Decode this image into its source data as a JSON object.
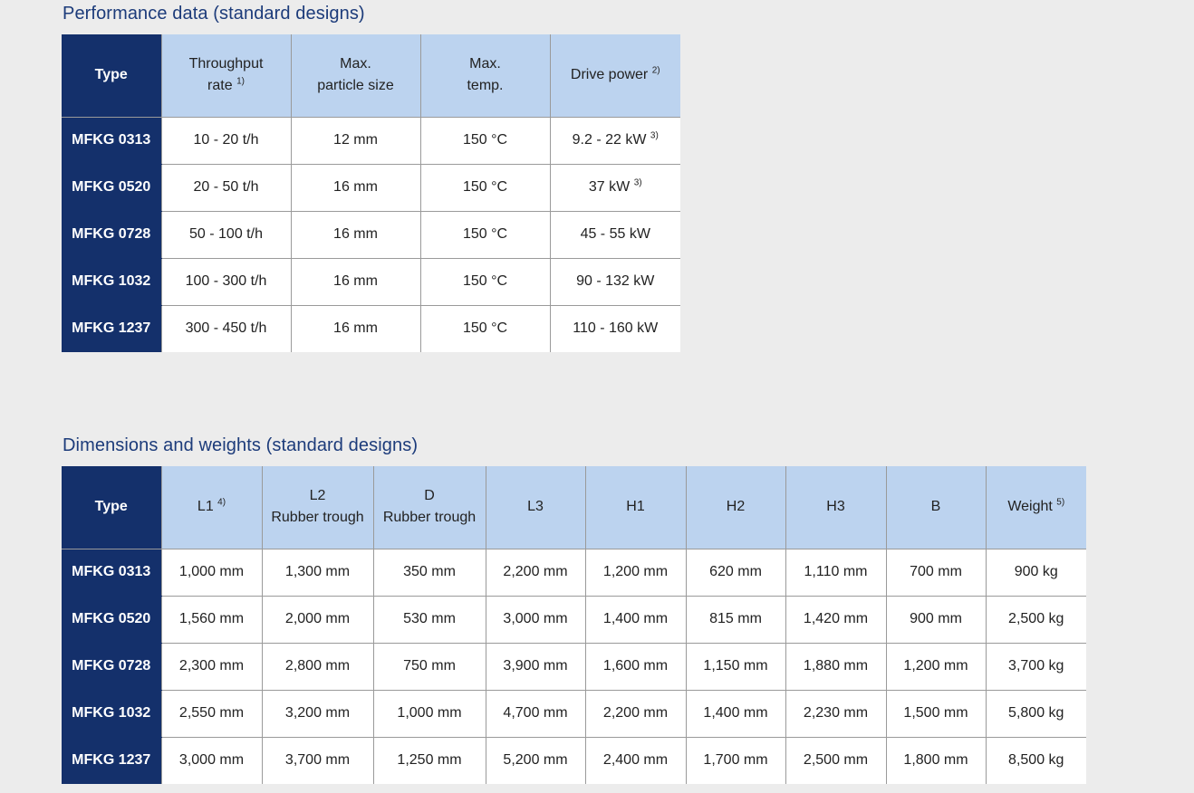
{
  "performance": {
    "title": "Performance data (standard designs)",
    "headers": {
      "type": "Type",
      "throughput_line1": "Throughput",
      "throughput_line2": "rate",
      "throughput_sup": "1)",
      "particle_line1": "Max.",
      "particle_line2": "particle size",
      "temp_line1": "Max.",
      "temp_line2": "temp.",
      "power": "Drive power",
      "power_sup": "2)"
    },
    "rows": [
      {
        "type": "MFKG 0313",
        "throughput": "10 - 20 t/h",
        "particle": "12 mm",
        "temp": "150 °C",
        "power": "9.2 - 22 kW",
        "power_sup": "3)"
      },
      {
        "type": "MFKG 0520",
        "throughput": "20 - 50 t/h",
        "particle": "16 mm",
        "temp": "150 °C",
        "power": "37 kW",
        "power_sup": "3)"
      },
      {
        "type": "MFKG 0728",
        "throughput": "50 - 100 t/h",
        "particle": "16 mm",
        "temp": "150 °C",
        "power": "45 - 55 kW",
        "power_sup": ""
      },
      {
        "type": "MFKG 1032",
        "throughput": "100 - 300 t/h",
        "particle": "16 mm",
        "temp": "150 °C",
        "power": "90 - 132 kW",
        "power_sup": ""
      },
      {
        "type": "MFKG 1237",
        "throughput": "300 - 450 t/h",
        "particle": "16 mm",
        "temp": "150 °C",
        "power": "110 - 160 kW",
        "power_sup": ""
      }
    ]
  },
  "dimensions": {
    "title": "Dimensions and weights (standard designs)",
    "headers": {
      "type": "Type",
      "l1": "L1",
      "l1_sup": "4)",
      "l2_line1": "L2",
      "l2_line2": "Rubber trough",
      "d_line1": "D",
      "d_line2": "Rubber trough",
      "l3": "L3",
      "h1": "H1",
      "h2": "H2",
      "h3": "H3",
      "b": "B",
      "weight": "Weight",
      "weight_sup": "5)"
    },
    "rows": [
      {
        "type": "MFKG 0313",
        "l1": "1,000 mm",
        "l2": "1,300 mm",
        "d": "350 mm",
        "l3": "2,200 mm",
        "h1": "1,200 mm",
        "h2": "620 mm",
        "h3": "1,110 mm",
        "b": "700 mm",
        "weight": "900 kg"
      },
      {
        "type": "MFKG 0520",
        "l1": "1,560 mm",
        "l2": "2,000 mm",
        "d": "530 mm",
        "l3": "3,000 mm",
        "h1": "1,400 mm",
        "h2": "815 mm",
        "h3": "1,420 mm",
        "b": "900 mm",
        "weight": "2,500 kg"
      },
      {
        "type": "MFKG 0728",
        "l1": "2,300 mm",
        "l2": "2,800 mm",
        "d": "750 mm",
        "l3": "3,900 mm",
        "h1": "1,600 mm",
        "h2": "1,150 mm",
        "h3": "1,880 mm",
        "b": "1,200 mm",
        "weight": "3,700 kg"
      },
      {
        "type": "MFKG 1032",
        "l1": "2,550 mm",
        "l2": "3,200 mm",
        "d": "1,000 mm",
        "l3": "4,700 mm",
        "h1": "2,200 mm",
        "h2": "1,400 mm",
        "h3": "2,230 mm",
        "b": "1,500 mm",
        "weight": "5,800 kg"
      },
      {
        "type": "MFKG 1237",
        "l1": "3,000 mm",
        "l2": "3,700 mm",
        "d": "1,250 mm",
        "l3": "5,200 mm",
        "h1": "2,400 mm",
        "h2": "1,700 mm",
        "h3": "2,500 mm",
        "b": "1,800 mm",
        "weight": "8,500 kg"
      }
    ]
  },
  "colors": {
    "title_text": "#1c3b7a",
    "type_column": "#14306b",
    "header_bg": "#bcd3ef",
    "page_bg": "#ececec"
  }
}
